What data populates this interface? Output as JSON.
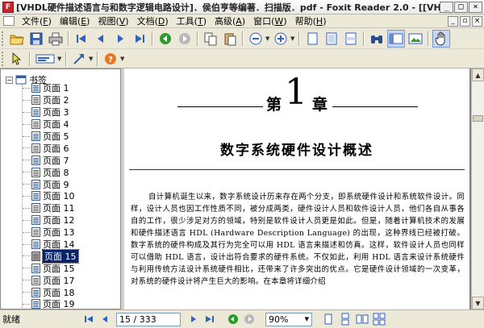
{
  "window": {
    "title": "[VHDL硬件描述语言与和数字逻辑电路设计]．侯伯亨等编著．扫描版．pdf - Foxit Reader 2.0 - [[VHDL硬...",
    "app_icon_text": "F",
    "buttons": {
      "minimize": "_",
      "maximize": "□",
      "close": "×"
    }
  },
  "menu": {
    "items": [
      {
        "label": "文件(",
        "acc": "F",
        "end": ")"
      },
      {
        "label": "编辑(",
        "acc": "E",
        "end": ")"
      },
      {
        "label": "视图(",
        "acc": "V",
        "end": ")"
      },
      {
        "label": "文档(",
        "acc": "D",
        "end": ")"
      },
      {
        "label": "工具(",
        "acc": "T",
        "end": ")"
      },
      {
        "label": "高级(",
        "acc": "A",
        "end": ")"
      },
      {
        "label": "窗口(",
        "acc": "W",
        "end": ")"
      },
      {
        "label": "帮助(",
        "acc": "H",
        "end": ")"
      }
    ],
    "mdi": {
      "minimize": "_",
      "restore": "▫",
      "close": "×"
    }
  },
  "bookmarks": {
    "root_label": "书签",
    "root_toggle": "−",
    "items": [
      "页面 1",
      "页面 2",
      "页面 3",
      "页面 4",
      "页面 5",
      "页面 6",
      "页面 7",
      "页面 8",
      "页面 9",
      "页面 10",
      "页面 11",
      "页面 12",
      "页面 13",
      "页面 14",
      "页面 15",
      "页面 15",
      "页面 17",
      "页面 18",
      "页面 19"
    ],
    "selected_index": 14
  },
  "document": {
    "chapter_prefix": "第",
    "chapter_number": "1",
    "chapter_suffix": "章",
    "title": "数字系统硬件设计概述",
    "paragraph": "自计算机诞生以来，数字系统设计历来存在两个分支，即系统硬件设计和系统软件设计。同样，设计人员也因工作性质不同，被分成两类，硬件设计人员和软件设计人员，他们各自从事各自的工作，很少涉足对方的领域，特别是软件设计人员更是如此。但是，随着计算机技术的发展和硬件描述语言 HDL (Hardware Description Language) 的出现，这种界线已经被打破。数字系统的硬件构成及其行为完全可以用 HDL 语言来描述和仿真。这样，软件设计人员也同样可以借助 HDL 语言，设计出符合要求的硬件系统。不仅如此，利用 HDL 语言来设计系统硬件与利用传统方法设计系统硬件相比，还带来了许多突出的优点。它是硬件设计领域的一次变革，对系统的硬件设计将产生巨大的影响。在本章将详细介绍"
  },
  "status": {
    "text": "就绪",
    "page_value": "15 / 333",
    "zoom_value": "90%"
  },
  "colors": {
    "selection": "#0a246a",
    "toolbar_bg": "#ece9d8",
    "nav_blue": "#3060c0",
    "nav_green": "#2c9a2c"
  }
}
